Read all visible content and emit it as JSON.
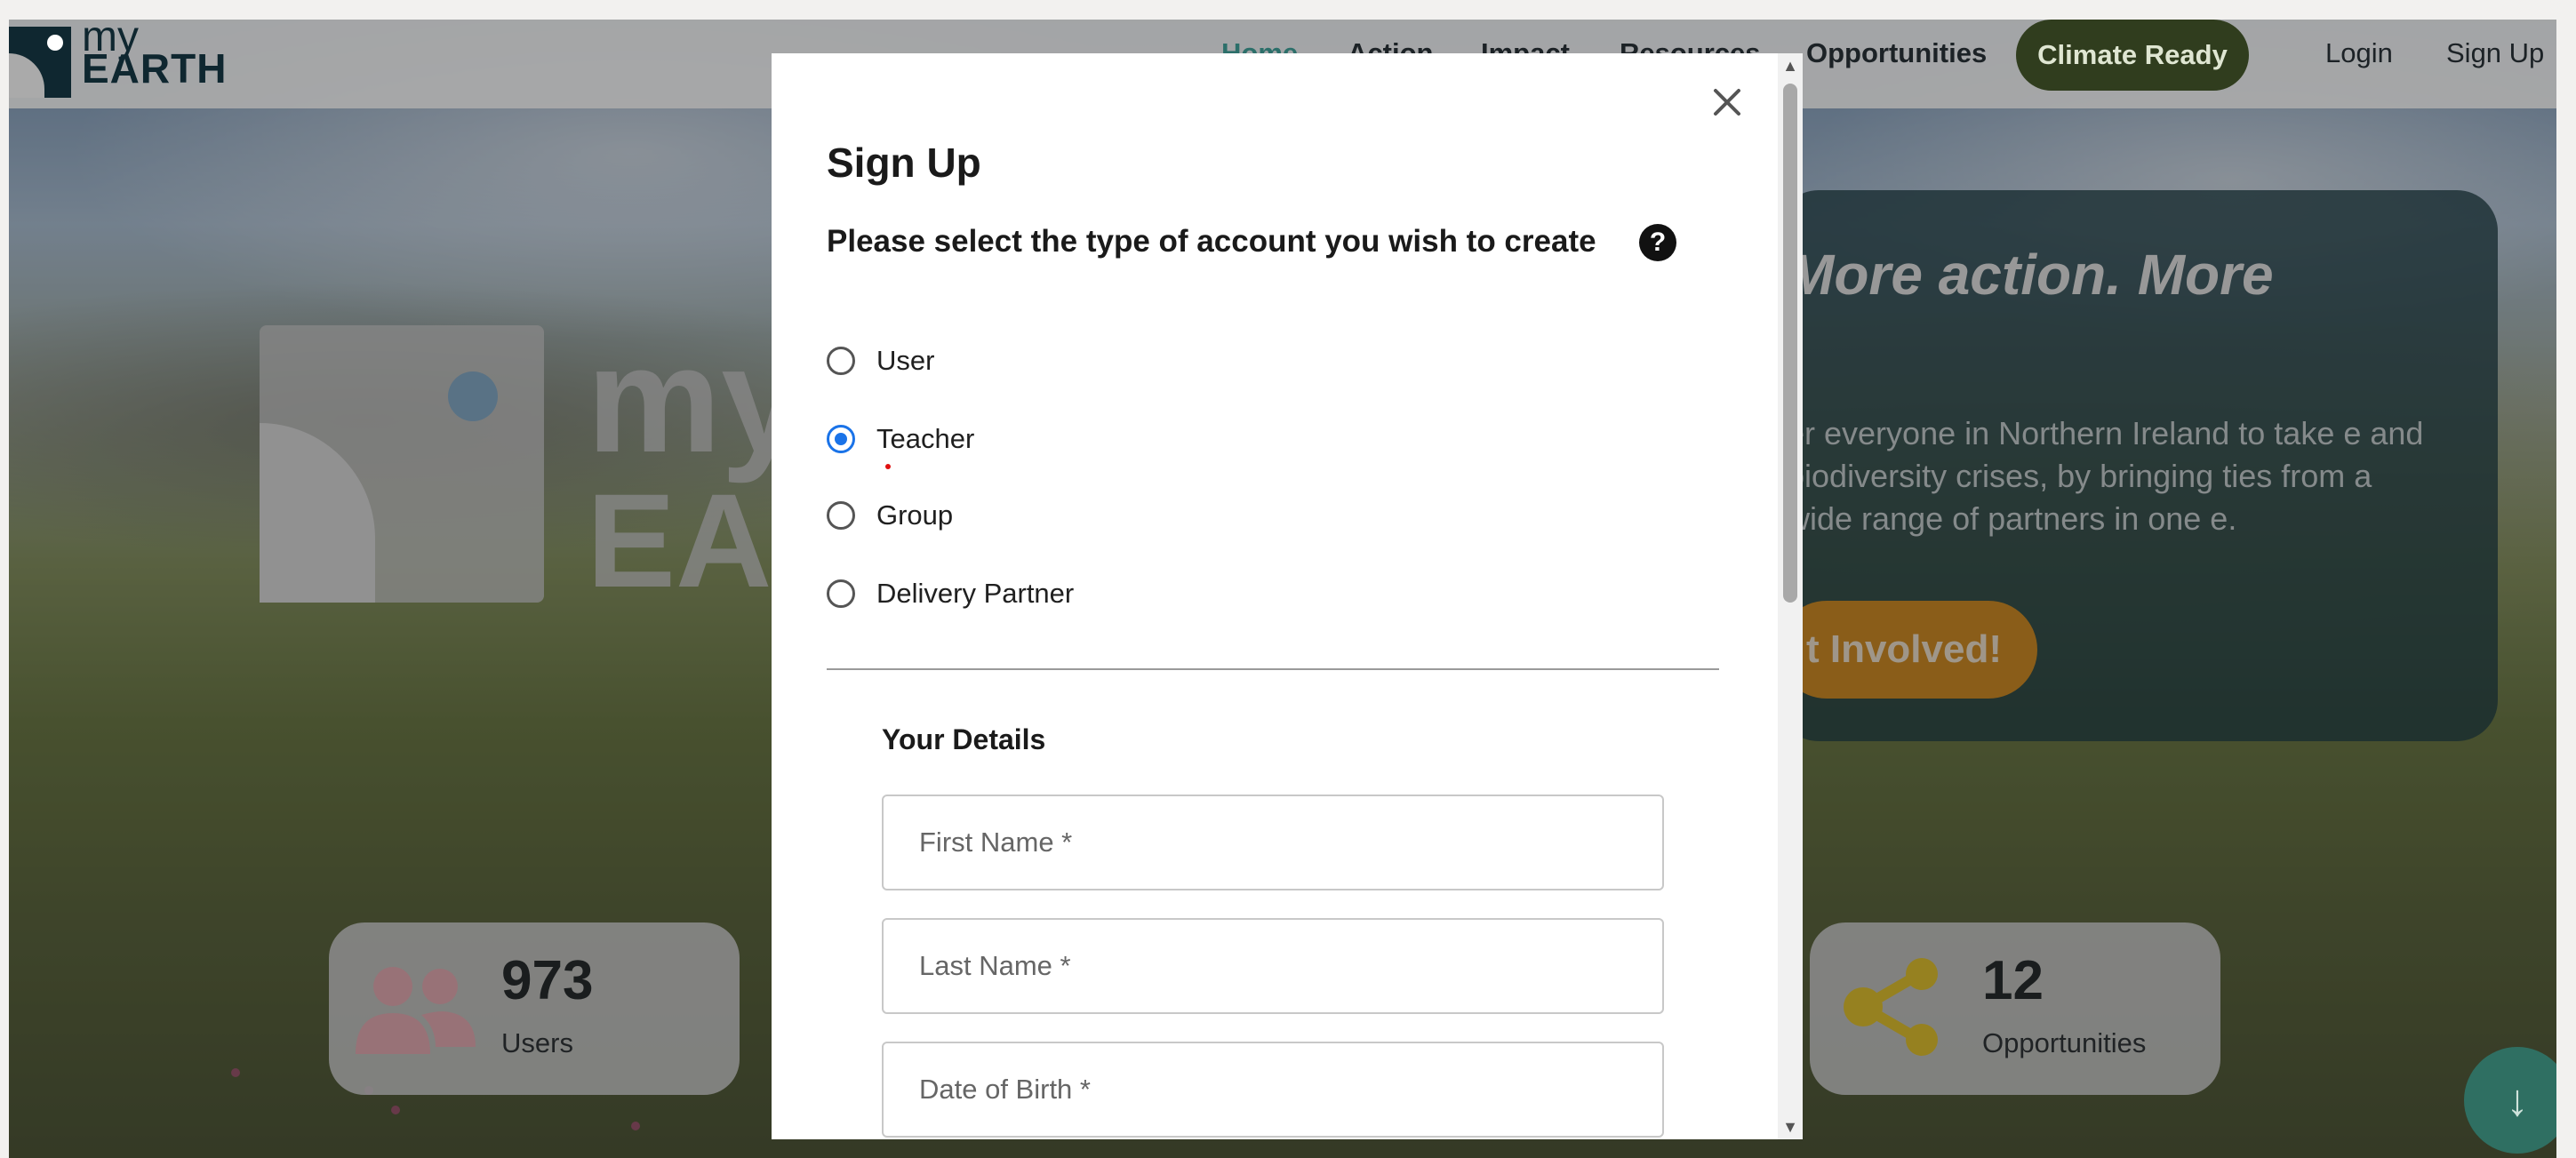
{
  "nav": {
    "logo": {
      "my": "my",
      "earth": "EARTH"
    },
    "items": [
      {
        "label": "Home",
        "active": true
      },
      {
        "label": "Action",
        "active": false
      },
      {
        "label": "Impact",
        "active": false
      },
      {
        "label": "Resources",
        "active": false
      },
      {
        "label": "Opportunities",
        "active": false
      }
    ],
    "cta": "Climate Ready",
    "login": "Login",
    "signup": "Sign Up"
  },
  "hero": {
    "logo_text_1": "my",
    "logo_text_2": "EA",
    "title": "More action. More",
    "paragraph": "er everyone in Northern Ireland to take e and biodiversity crises, by bringing ties from a wide range of partners in one e.",
    "button": "t Involved!"
  },
  "stats": [
    {
      "value": "973",
      "label": "Users",
      "icon": "users-icon",
      "color": "#e8a7b0"
    },
    {
      "value": "12",
      "label": "Opportunities",
      "icon": "share-icon",
      "color": "#e6c21a"
    }
  ],
  "modal": {
    "title": "Sign Up",
    "subtitle": "Please select the type of account you wish to create",
    "help_icon": "?",
    "account_types": [
      {
        "label": "User",
        "checked": false
      },
      {
        "label": "Teacher",
        "checked": true
      },
      {
        "label": "Group",
        "checked": false
      },
      {
        "label": "Delivery Partner",
        "checked": false
      }
    ],
    "section_title": "Your Details",
    "fields": {
      "first_name": {
        "placeholder": "First Name *",
        "value": ""
      },
      "last_name": {
        "placeholder": "Last Name *",
        "value": ""
      },
      "dob": {
        "placeholder": "Date of Birth *",
        "value": ""
      }
    },
    "close_icon": "close-icon"
  },
  "colors": {
    "accent_blue": "#1a73e8",
    "nav_cta_bg": "#303d1e",
    "hero_card_bg": "#0a2d34",
    "hero_button": "#d0830e",
    "fab": "#2f6f62"
  }
}
